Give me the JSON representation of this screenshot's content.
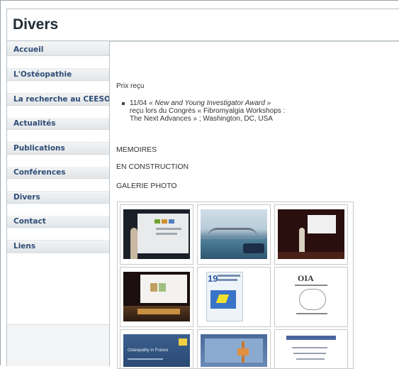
{
  "header": {
    "title": "Divers"
  },
  "sidebar": {
    "items": [
      {
        "label": "Accueil"
      },
      {
        "label": "L'Ostéopathie"
      },
      {
        "label": "La recherche au CEESO"
      },
      {
        "label": "Actualités"
      },
      {
        "label": "Publications"
      },
      {
        "label": "Conférences"
      },
      {
        "label": "Divers"
      },
      {
        "label": "Contact"
      },
      {
        "label": "Liens"
      }
    ]
  },
  "main": {
    "prize_title": "Prix reçu",
    "prize_item": {
      "date": "11/04",
      "award": "« New and Young Investigator Award »",
      "line2": "reçu lors du Congrès « Fibromyalgia Workshops :",
      "line3": "The Next Advances » ; Washington, DC, USA"
    },
    "memoires_title": "MEMOIRES",
    "memoires_status": "EN CONSTRUCTION",
    "gallery_title": "GALERIE PHOTO"
  },
  "gallery": {
    "thumbs": [
      {
        "name": "conference-presenter-photo"
      },
      {
        "name": "harbor-bridge-photo"
      },
      {
        "name": "stage-presentation-photo"
      },
      {
        "name": "projection-room-photo"
      },
      {
        "name": "congress-poster-19"
      },
      {
        "name": "oia-annual-conference-cover",
        "text": "OIA"
      },
      {
        "name": "osteopathy-in-france-cover",
        "text": "Osteopathy in France"
      },
      {
        "name": "paris-brochure-cover"
      },
      {
        "name": "document-cover"
      }
    ],
    "badge_number": "19"
  }
}
